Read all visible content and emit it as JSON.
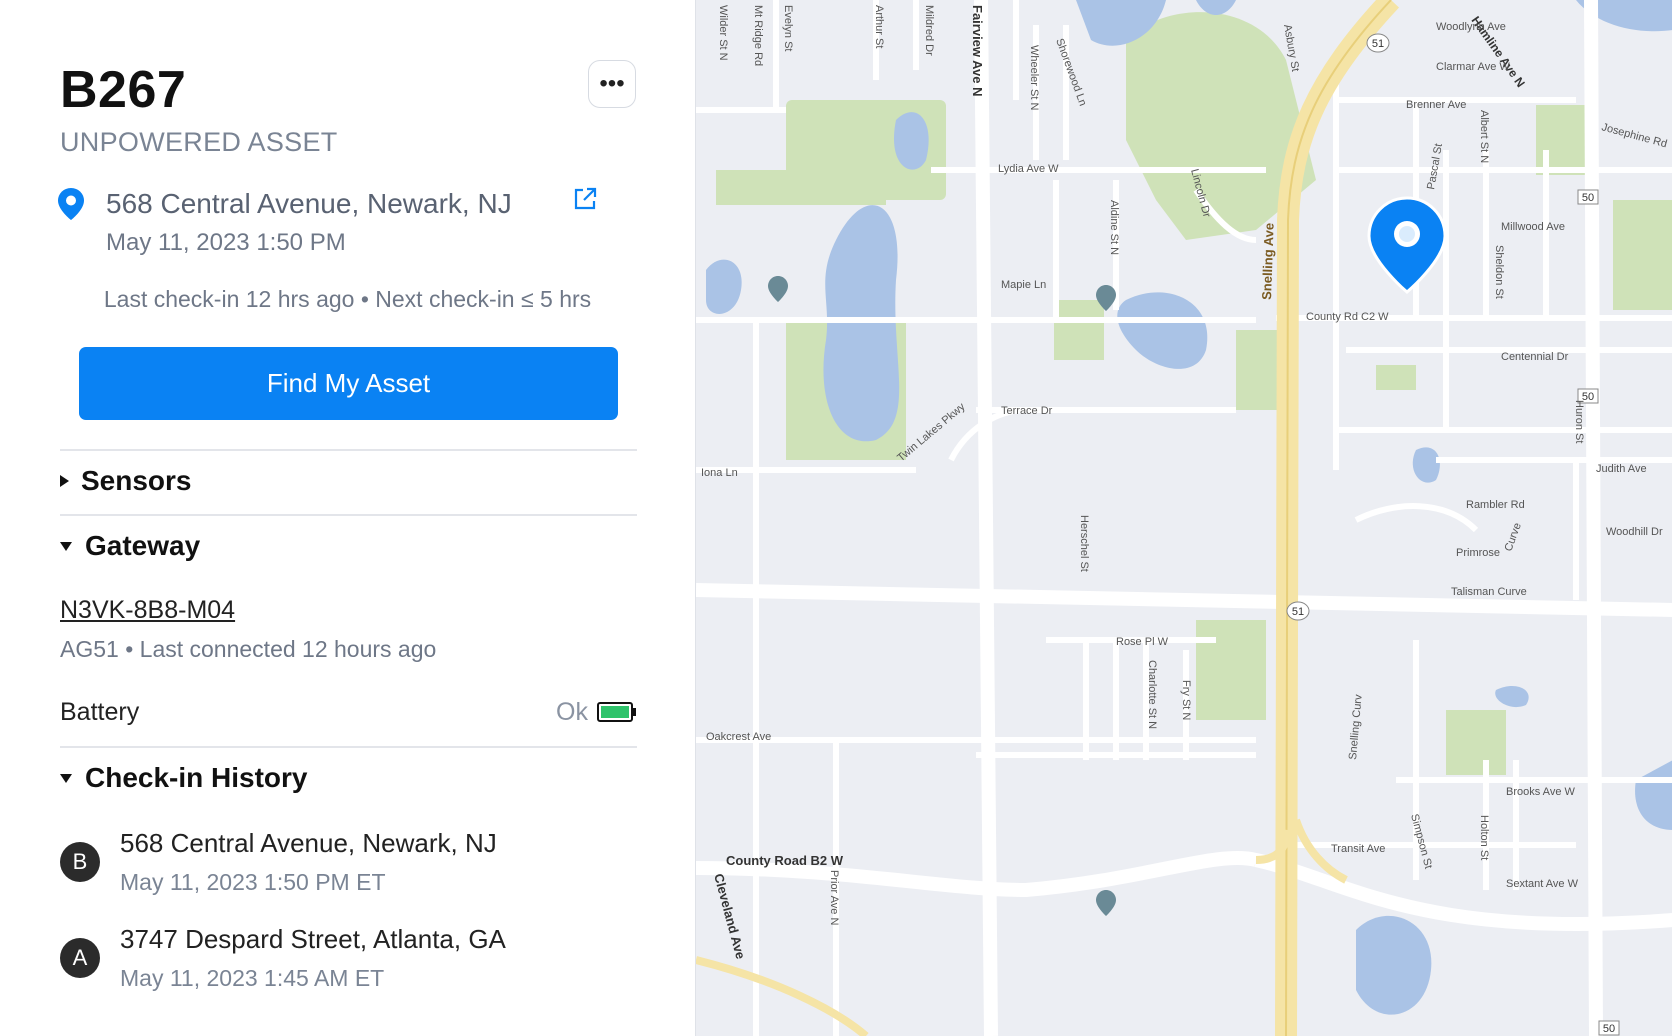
{
  "asset": {
    "title": "B267",
    "type_label": "UNPOWERED ASSET",
    "more_label": "•••",
    "location": "568 Central Avenue, Newark, NJ",
    "location_time": "May 11, 2023 1:50 PM",
    "checkin_info": "Last check-in 12 hrs ago • Next check-in ≤ 5 hrs",
    "find_button": "Find My Asset"
  },
  "sections": {
    "sensors": "Sensors",
    "gateway": "Gateway",
    "history": "Check-in History"
  },
  "gateway": {
    "id": "N3VK-8B8-M04",
    "sub": "AG51 • Last connected 12 hours ago",
    "battery_label": "Battery",
    "battery_status": "Ok",
    "battery_level": 1.0,
    "battery_color": "#2fc36b"
  },
  "history": [
    {
      "badge": "B",
      "address": "568 Central Avenue, Newark, NJ",
      "time": "May 11, 2023 1:50 PM ET"
    },
    {
      "badge": "A",
      "address": "3747 Despard Street, Atlanta, GA",
      "time": "May 11, 2023 1:45 AM ET"
    }
  ],
  "colors": {
    "accent": "#0a82f3",
    "badge": "#2b2b2b",
    "park": "#cfe2b8",
    "water": "#aac3e6",
    "highway": "#f5e4a6"
  },
  "map": {
    "streets_vertical": [
      "Wilder St N",
      "Mt Ridge Rd",
      "Evelyn St",
      "Arthur St",
      "Mildred Dr",
      "Fairview Ave N",
      "Wheeler St N",
      "Shorewood Ln",
      "Asbury St",
      "Hamline Ave N",
      "Lincoln Dr",
      "Aldine St N",
      "Snelling Ave",
      "Pascal St",
      "Albert St N",
      "Sheldon St",
      "Herschel St",
      "Charlotte St N",
      "Fry St N",
      "Huron St",
      "Prior Ave N",
      "Cleveland Ave",
      "Simpson St",
      "Holton St",
      "Snelling Curv"
    ],
    "streets_horizontal": [
      "Woodlynn Ave",
      "Clarmar Ave W",
      "Brenner Ave",
      "Josephine Rd",
      "Lydia Ave W",
      "Millwood Ave",
      "Mapie Ln",
      "County Rd C2 W",
      "Centennial Dr",
      "Terrace Dr",
      "Twin Lakes Pkwy",
      "Iona Ln",
      "Judith Ave",
      "Rambler Rd",
      "Primrose",
      "Curve",
      "Woodhill Dr",
      "Talisman Curve",
      "Rose Pl W",
      "Oakcrest Ave",
      "Brooks Ave W",
      "Transit Ave",
      "Sextant Ave W",
      "County Road B2 W"
    ],
    "route_shields": [
      "51",
      "50",
      "51",
      "50",
      "50"
    ],
    "marker": "location-pin"
  }
}
